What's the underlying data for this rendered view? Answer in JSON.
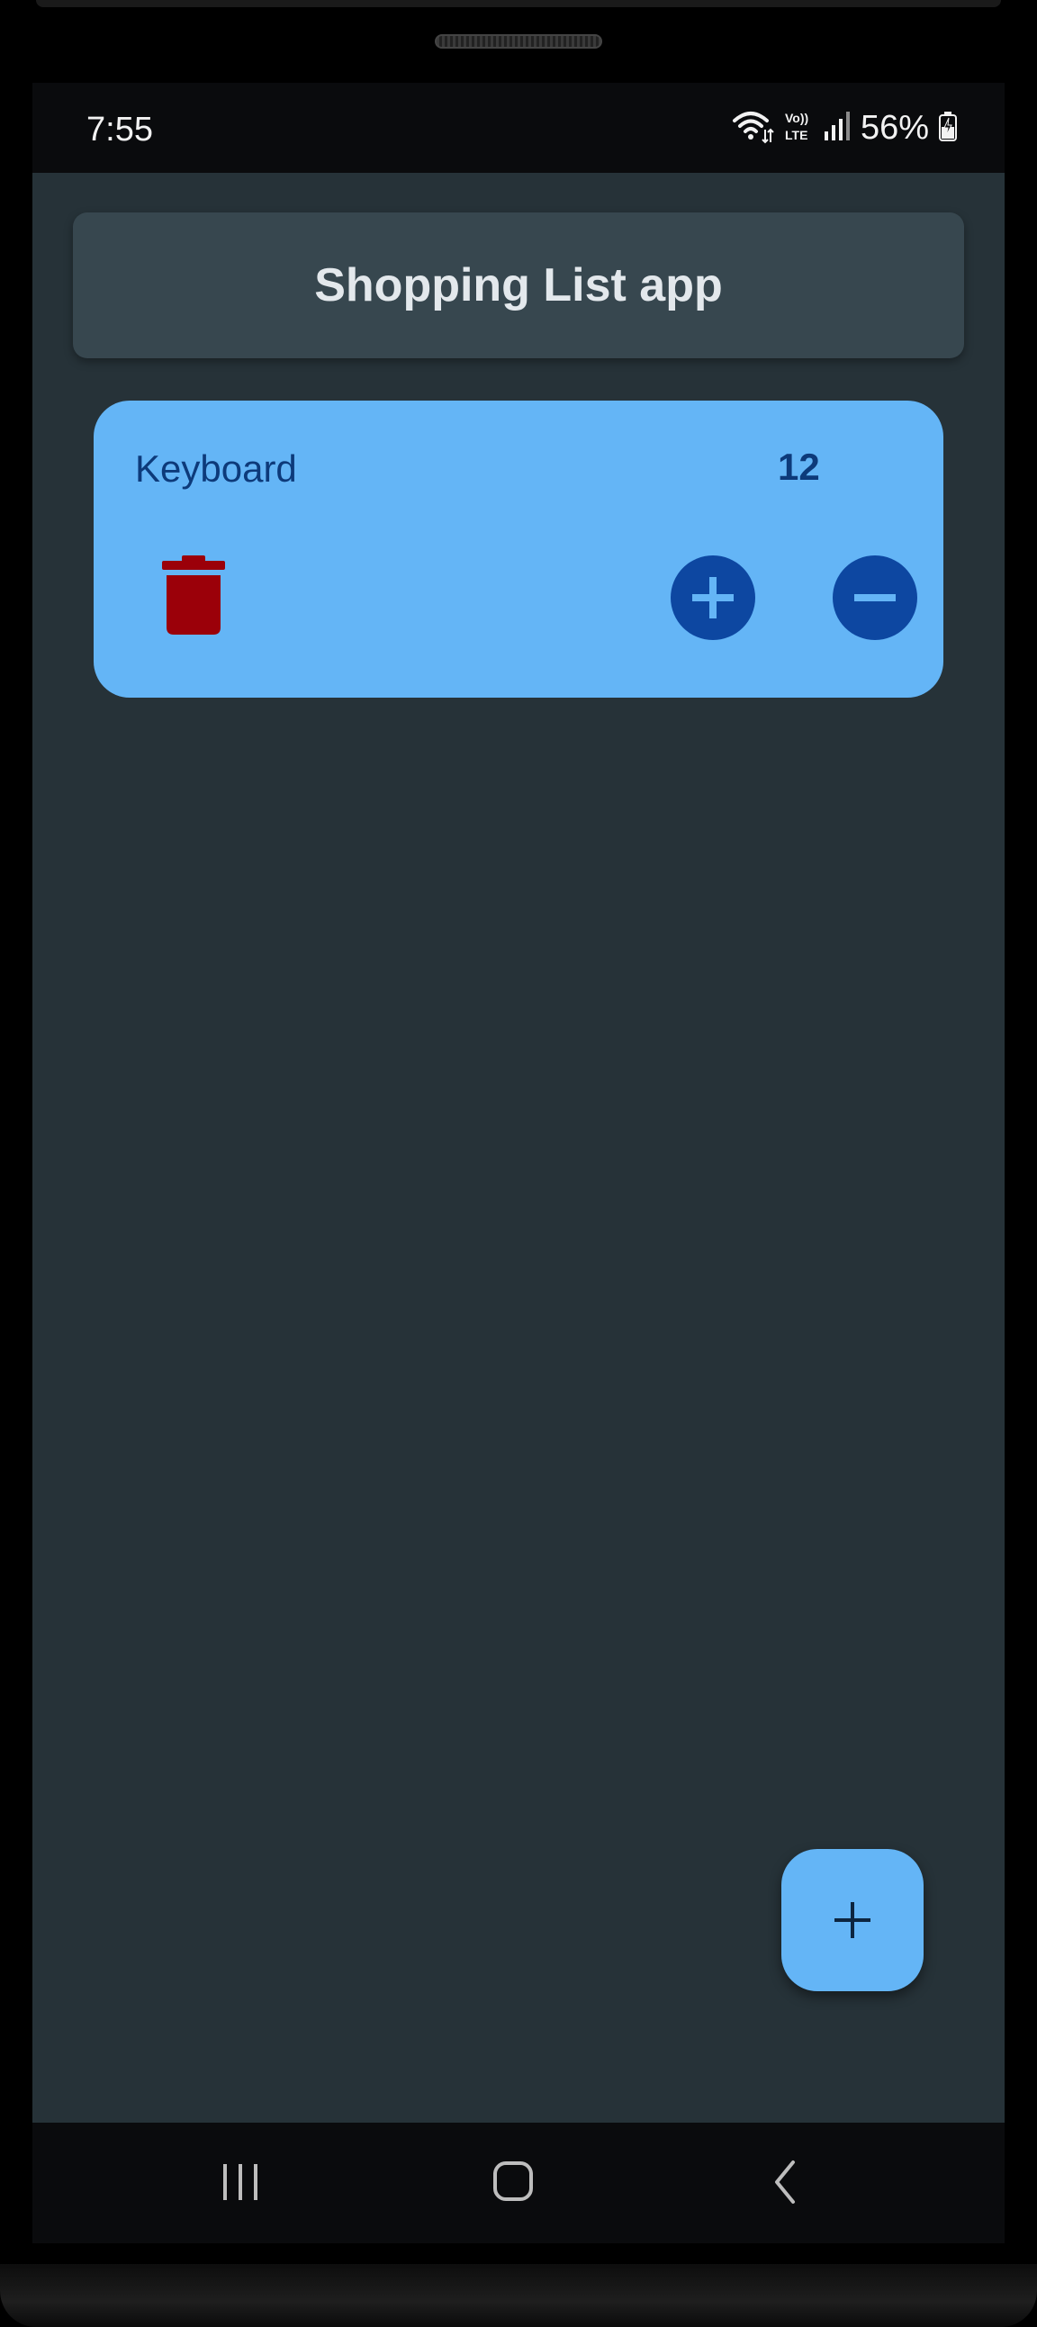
{
  "status_bar": {
    "time": "7:55",
    "battery": "56%",
    "volte_top": "Vo))",
    "volte_bottom": "LTE",
    "icons": [
      "wifi-icon",
      "volte-icon",
      "signal-icon",
      "battery-charging-icon"
    ]
  },
  "app": {
    "title": "Shopping List app"
  },
  "items": [
    {
      "name": "Keyboard",
      "quantity": "12"
    }
  ],
  "icons": {
    "delete": "trash-icon",
    "increase": "plus-circle-icon",
    "decrease": "minus-circle-icon",
    "add": "add-icon"
  },
  "navigation": {
    "recents": "recents-icon",
    "home": "home-icon",
    "back": "back-icon"
  },
  "colors": {
    "background": "#263238",
    "app_bar": "#37474f",
    "card": "#64b5f6",
    "accent_dark": "#0d47a1",
    "text_dark": "#0d3a7a",
    "delete": "#9b0009",
    "title_text": "#e3e8ec"
  }
}
